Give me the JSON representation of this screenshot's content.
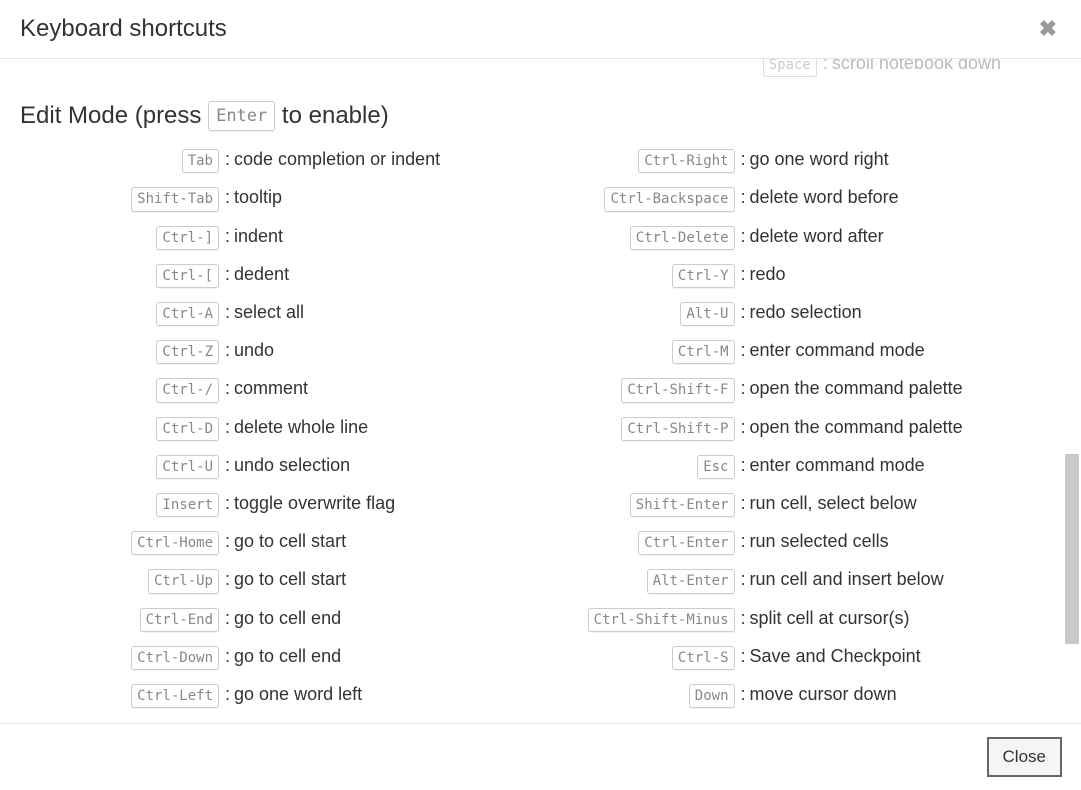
{
  "modal": {
    "title": "Keyboard shortcuts",
    "close_button_label": "Close"
  },
  "prev_section_tail": {
    "key": "Space",
    "desc": "scroll notebook down"
  },
  "section": {
    "heading_prefix": "Edit Mode (press ",
    "heading_key": "Enter",
    "heading_suffix": " to enable)"
  },
  "left": [
    {
      "key": "Tab",
      "desc": "code completion or indent"
    },
    {
      "key": "Shift-Tab",
      "desc": "tooltip"
    },
    {
      "key": "Ctrl-]",
      "desc": "indent"
    },
    {
      "key": "Ctrl-[",
      "desc": "dedent"
    },
    {
      "key": "Ctrl-A",
      "desc": "select all"
    },
    {
      "key": "Ctrl-Z",
      "desc": "undo"
    },
    {
      "key": "Ctrl-/",
      "desc": "comment"
    },
    {
      "key": "Ctrl-D",
      "desc": "delete whole line"
    },
    {
      "key": "Ctrl-U",
      "desc": "undo selection"
    },
    {
      "key": "Insert",
      "desc": "toggle overwrite flag"
    },
    {
      "key": "Ctrl-Home",
      "desc": "go to cell start"
    },
    {
      "key": "Ctrl-Up",
      "desc": "go to cell start"
    },
    {
      "key": "Ctrl-End",
      "desc": "go to cell end"
    },
    {
      "key": "Ctrl-Down",
      "desc": "go to cell end"
    },
    {
      "key": "Ctrl-Left",
      "desc": "go one word left"
    }
  ],
  "right": [
    {
      "key": "Ctrl-Right",
      "desc": "go one word right"
    },
    {
      "key": "Ctrl-Backspace",
      "desc": "delete word before"
    },
    {
      "key": "Ctrl-Delete",
      "desc": "delete word after"
    },
    {
      "key": "Ctrl-Y",
      "desc": "redo"
    },
    {
      "key": "Alt-U",
      "desc": "redo selection"
    },
    {
      "key": "Ctrl-M",
      "desc": "enter command mode"
    },
    {
      "key": "Ctrl-Shift-F",
      "desc": "open the command palette"
    },
    {
      "key": "Ctrl-Shift-P",
      "desc": "open the command palette"
    },
    {
      "key": "Esc",
      "desc": "enter command mode"
    },
    {
      "key": "Shift-Enter",
      "desc": "run cell, select below"
    },
    {
      "key": "Ctrl-Enter",
      "desc": "run selected cells"
    },
    {
      "key": "Alt-Enter",
      "desc": "run cell and insert below"
    },
    {
      "key": "Ctrl-Shift-Minus",
      "desc": "split cell at cursor(s)"
    },
    {
      "key": "Ctrl-S",
      "desc": "Save and Checkpoint"
    },
    {
      "key": "Down",
      "desc": "move cursor down"
    }
  ]
}
